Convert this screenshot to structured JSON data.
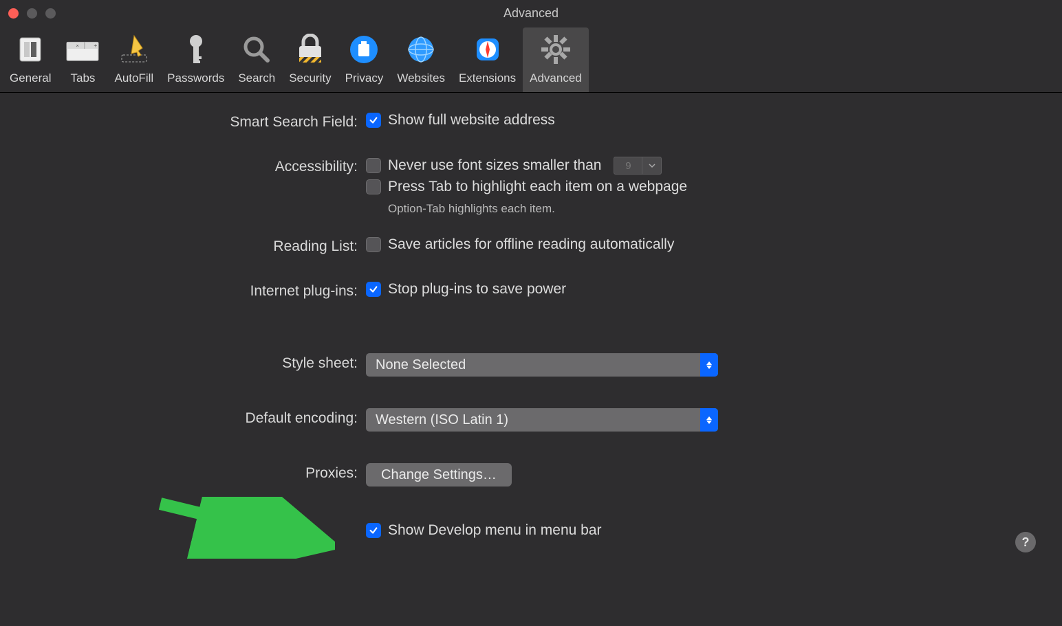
{
  "window": {
    "title": "Advanced"
  },
  "toolbar": {
    "items": [
      {
        "label": "General"
      },
      {
        "label": "Tabs"
      },
      {
        "label": "AutoFill"
      },
      {
        "label": "Passwords"
      },
      {
        "label": "Search"
      },
      {
        "label": "Security"
      },
      {
        "label": "Privacy"
      },
      {
        "label": "Websites"
      },
      {
        "label": "Extensions"
      },
      {
        "label": "Advanced"
      }
    ]
  },
  "sections": {
    "smartSearch": {
      "label": "Smart Search Field:",
      "showFullAddress": "Show full website address"
    },
    "accessibility": {
      "label": "Accessibility:",
      "neverSmaller": "Never use font sizes smaller than",
      "fontSize": "9",
      "pressTab": "Press Tab to highlight each item on a webpage",
      "hint": "Option-Tab highlights each item."
    },
    "readingList": {
      "label": "Reading List:",
      "saveOffline": "Save articles for offline reading automatically"
    },
    "plugins": {
      "label": "Internet plug-ins:",
      "stopPlugins": "Stop plug-ins to save power"
    },
    "styleSheet": {
      "label": "Style sheet:",
      "value": "None Selected"
    },
    "encoding": {
      "label": "Default encoding:",
      "value": "Western (ISO Latin 1)"
    },
    "proxies": {
      "label": "Proxies:",
      "button": "Change Settings…"
    },
    "develop": {
      "label": "Show Develop menu in menu bar"
    }
  },
  "help": "?"
}
